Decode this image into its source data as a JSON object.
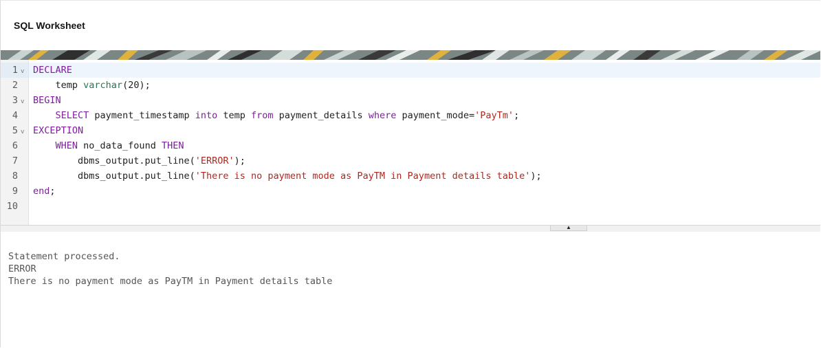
{
  "header": {
    "title": "SQL Worksheet"
  },
  "editor": {
    "lines": [
      {
        "number": "1",
        "foldable": true,
        "tokens": [
          {
            "t": "DECLARE",
            "c": "kw"
          }
        ]
      },
      {
        "number": "2",
        "foldable": false,
        "tokens": [
          {
            "t": "    temp ",
            "c": ""
          },
          {
            "t": "varchar",
            "c": "ty"
          },
          {
            "t": "(20);",
            "c": ""
          }
        ]
      },
      {
        "number": "3",
        "foldable": true,
        "tokens": [
          {
            "t": "BEGIN",
            "c": "kw"
          }
        ]
      },
      {
        "number": "4",
        "foldable": false,
        "tokens": [
          {
            "t": "    ",
            "c": ""
          },
          {
            "t": "SELECT",
            "c": "kw"
          },
          {
            "t": " payment_timestamp ",
            "c": ""
          },
          {
            "t": "into",
            "c": "kw"
          },
          {
            "t": " temp ",
            "c": ""
          },
          {
            "t": "from",
            "c": "kw"
          },
          {
            "t": " payment_details ",
            "c": ""
          },
          {
            "t": "where",
            "c": "kw"
          },
          {
            "t": " payment_mode=",
            "c": ""
          },
          {
            "t": "'PayTm'",
            "c": "str"
          },
          {
            "t": ";",
            "c": ""
          }
        ]
      },
      {
        "number": "5",
        "foldable": true,
        "tokens": [
          {
            "t": "EXCEPTION",
            "c": "kw"
          }
        ]
      },
      {
        "number": "6",
        "foldable": false,
        "tokens": [
          {
            "t": "    ",
            "c": ""
          },
          {
            "t": "WHEN",
            "c": "kw"
          },
          {
            "t": " no_data_found ",
            "c": ""
          },
          {
            "t": "THEN",
            "c": "kw"
          }
        ]
      },
      {
        "number": "7",
        "foldable": false,
        "tokens": [
          {
            "t": "        dbms_output.put_line(",
            "c": ""
          },
          {
            "t": "'ERROR'",
            "c": "str"
          },
          {
            "t": ");",
            "c": ""
          }
        ]
      },
      {
        "number": "8",
        "foldable": false,
        "tokens": [
          {
            "t": "        dbms_output.put_line(",
            "c": ""
          },
          {
            "t": "'There is no payment mode as PayTM in Payment details table'",
            "c": "str"
          },
          {
            "t": ");",
            "c": ""
          }
        ]
      },
      {
        "number": "9",
        "foldable": false,
        "tokens": [
          {
            "t": "end",
            "c": "kw"
          },
          {
            "t": ";",
            "c": ""
          }
        ]
      },
      {
        "number": "10",
        "foldable": false,
        "tokens": []
      }
    ],
    "fold_icon": "chevron-down-icon",
    "fold_glyph": "v"
  },
  "splitter": {
    "icon": "caret-up-icon",
    "glyph": "▲"
  },
  "output": {
    "lines": [
      "Statement processed.",
      "ERROR",
      "There is no payment mode as PayTM in Payment details table"
    ]
  },
  "colors": {
    "keyword": "#7d1e9e",
    "type": "#217a55",
    "string": "#b3261e",
    "output_text": "#555555"
  }
}
